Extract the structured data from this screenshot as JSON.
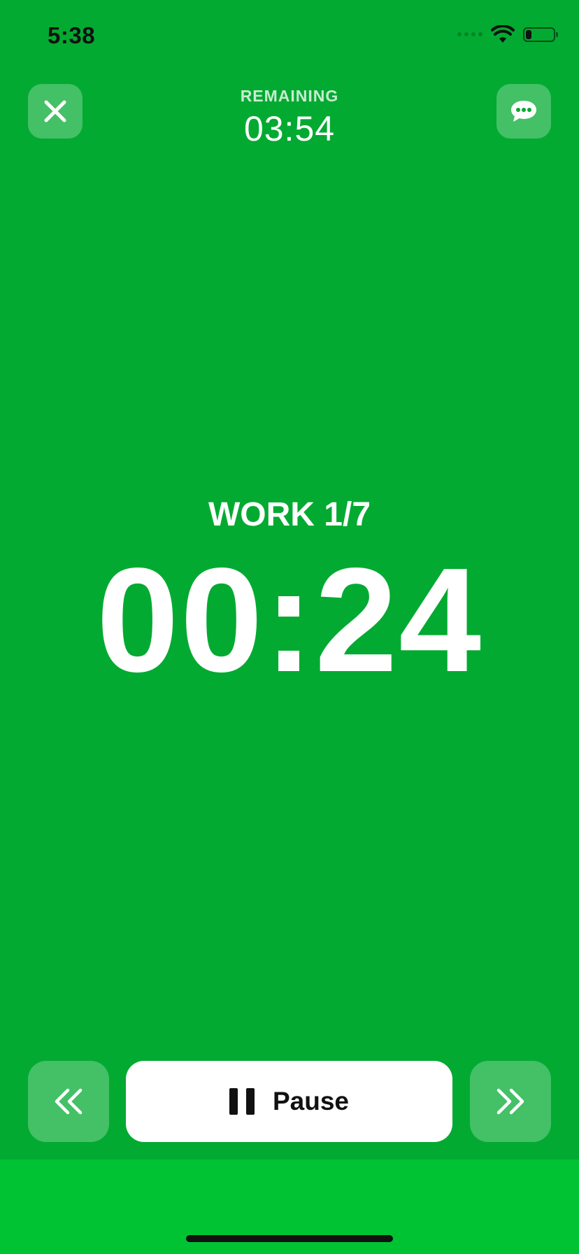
{
  "status_bar": {
    "time": "5:38",
    "icons": [
      "cellular-signal-icon",
      "wifi-icon",
      "battery-icon"
    ],
    "battery_level": 0.22
  },
  "header": {
    "remaining_label": "REMAINING",
    "remaining_time": "03:54",
    "close_icon": "close-icon",
    "chat_icon": "chat-bubble-icon"
  },
  "timer": {
    "phase": "WORK 1/7",
    "time": "00:24"
  },
  "controls": {
    "prev_icon": "rewind-icon",
    "pause_icon": "pause-icon",
    "pause_label": "Pause",
    "next_icon": "fast-forward-icon"
  },
  "colors": {
    "background": "#03aa31",
    "bottom_band": "#00c334",
    "text": "#ffffff"
  }
}
